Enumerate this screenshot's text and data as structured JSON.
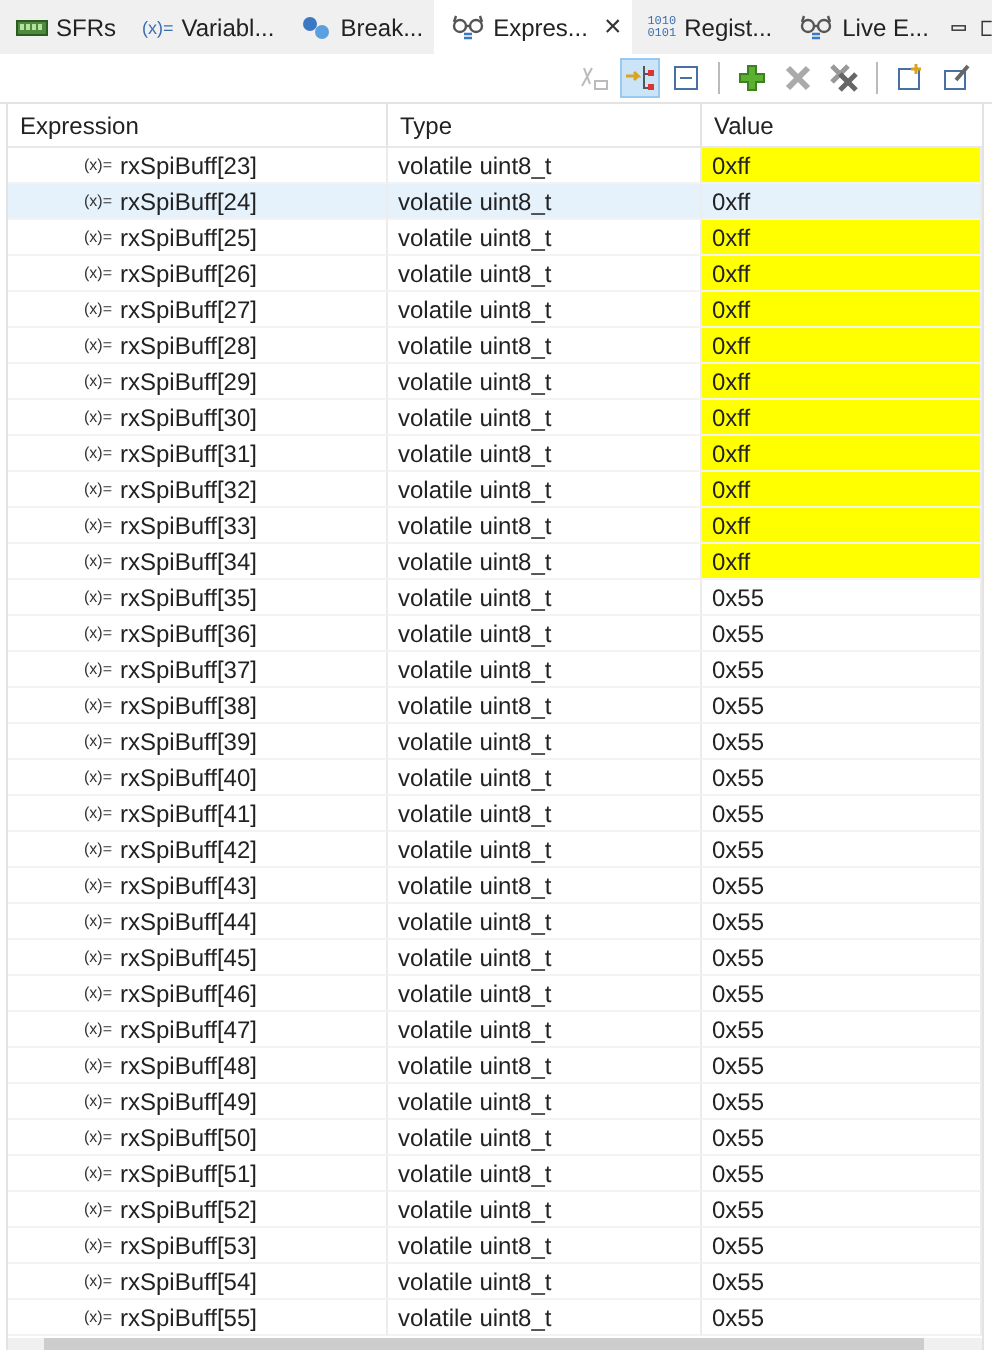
{
  "tabs": [
    {
      "label": "SFRs",
      "kind": "chip",
      "selected": false
    },
    {
      "label": "Variabl...",
      "kind": "text",
      "icon_text": "(x)=",
      "selected": false
    },
    {
      "label": "Break...",
      "kind": "dots",
      "selected": false
    },
    {
      "label": "Expres...",
      "kind": "glasses",
      "selected": true,
      "close": "×"
    },
    {
      "label": "Regist...",
      "kind": "binary",
      "icon_text": "1010\n0101",
      "selected": false
    },
    {
      "label": "Live E...",
      "kind": "glasses",
      "selected": false
    }
  ],
  "toolbar": [
    {
      "kind": "disabled-var",
      "on": false
    },
    {
      "kind": "arrow-tree",
      "on": true
    },
    {
      "kind": "collapse",
      "on": false
    },
    {
      "kind": "sep"
    },
    {
      "kind": "add",
      "on": false
    },
    {
      "kind": "remove",
      "on": false
    },
    {
      "kind": "remove-all",
      "on": false
    },
    {
      "kind": "sep"
    },
    {
      "kind": "new",
      "on": false
    },
    {
      "kind": "edit",
      "on": false
    }
  ],
  "table": {
    "columns": [
      "Expression",
      "Type",
      "Value"
    ],
    "rows": [
      {
        "icon": "(x)=",
        "expression": "rxSpiBuff[23]",
        "type": "volatile uint8_t",
        "value": "0xff",
        "changed": true,
        "selected": false
      },
      {
        "icon": "(x)=",
        "expression": "rxSpiBuff[24]",
        "type": "volatile uint8_t",
        "value": "0xff",
        "changed": false,
        "selected": true
      },
      {
        "icon": "(x)=",
        "expression": "rxSpiBuff[25]",
        "type": "volatile uint8_t",
        "value": "0xff",
        "changed": true,
        "selected": false
      },
      {
        "icon": "(x)=",
        "expression": "rxSpiBuff[26]",
        "type": "volatile uint8_t",
        "value": "0xff",
        "changed": true,
        "selected": false
      },
      {
        "icon": "(x)=",
        "expression": "rxSpiBuff[27]",
        "type": "volatile uint8_t",
        "value": "0xff",
        "changed": true,
        "selected": false
      },
      {
        "icon": "(x)=",
        "expression": "rxSpiBuff[28]",
        "type": "volatile uint8_t",
        "value": "0xff",
        "changed": true,
        "selected": false
      },
      {
        "icon": "(x)=",
        "expression": "rxSpiBuff[29]",
        "type": "volatile uint8_t",
        "value": "0xff",
        "changed": true,
        "selected": false
      },
      {
        "icon": "(x)=",
        "expression": "rxSpiBuff[30]",
        "type": "volatile uint8_t",
        "value": "0xff",
        "changed": true,
        "selected": false
      },
      {
        "icon": "(x)=",
        "expression": "rxSpiBuff[31]",
        "type": "volatile uint8_t",
        "value": "0xff",
        "changed": true,
        "selected": false
      },
      {
        "icon": "(x)=",
        "expression": "rxSpiBuff[32]",
        "type": "volatile uint8_t",
        "value": "0xff",
        "changed": true,
        "selected": false
      },
      {
        "icon": "(x)=",
        "expression": "rxSpiBuff[33]",
        "type": "volatile uint8_t",
        "value": "0xff",
        "changed": true,
        "selected": false
      },
      {
        "icon": "(x)=",
        "expression": "rxSpiBuff[34]",
        "type": "volatile uint8_t",
        "value": "0xff",
        "changed": true,
        "selected": false
      },
      {
        "icon": "(x)=",
        "expression": "rxSpiBuff[35]",
        "type": "volatile uint8_t",
        "value": "0x55",
        "changed": false,
        "selected": false
      },
      {
        "icon": "(x)=",
        "expression": "rxSpiBuff[36]",
        "type": "volatile uint8_t",
        "value": "0x55",
        "changed": false,
        "selected": false
      },
      {
        "icon": "(x)=",
        "expression": "rxSpiBuff[37]",
        "type": "volatile uint8_t",
        "value": "0x55",
        "changed": false,
        "selected": false
      },
      {
        "icon": "(x)=",
        "expression": "rxSpiBuff[38]",
        "type": "volatile uint8_t",
        "value": "0x55",
        "changed": false,
        "selected": false
      },
      {
        "icon": "(x)=",
        "expression": "rxSpiBuff[39]",
        "type": "volatile uint8_t",
        "value": "0x55",
        "changed": false,
        "selected": false
      },
      {
        "icon": "(x)=",
        "expression": "rxSpiBuff[40]",
        "type": "volatile uint8_t",
        "value": "0x55",
        "changed": false,
        "selected": false
      },
      {
        "icon": "(x)=",
        "expression": "rxSpiBuff[41]",
        "type": "volatile uint8_t",
        "value": "0x55",
        "changed": false,
        "selected": false
      },
      {
        "icon": "(x)=",
        "expression": "rxSpiBuff[42]",
        "type": "volatile uint8_t",
        "value": "0x55",
        "changed": false,
        "selected": false
      },
      {
        "icon": "(x)=",
        "expression": "rxSpiBuff[43]",
        "type": "volatile uint8_t",
        "value": "0x55",
        "changed": false,
        "selected": false
      },
      {
        "icon": "(x)=",
        "expression": "rxSpiBuff[44]",
        "type": "volatile uint8_t",
        "value": "0x55",
        "changed": false,
        "selected": false
      },
      {
        "icon": "(x)=",
        "expression": "rxSpiBuff[45]",
        "type": "volatile uint8_t",
        "value": "0x55",
        "changed": false,
        "selected": false
      },
      {
        "icon": "(x)=",
        "expression": "rxSpiBuff[46]",
        "type": "volatile uint8_t",
        "value": "0x55",
        "changed": false,
        "selected": false
      },
      {
        "icon": "(x)=",
        "expression": "rxSpiBuff[47]",
        "type": "volatile uint8_t",
        "value": "0x55",
        "changed": false,
        "selected": false
      },
      {
        "icon": "(x)=",
        "expression": "rxSpiBuff[48]",
        "type": "volatile uint8_t",
        "value": "0x55",
        "changed": false,
        "selected": false
      },
      {
        "icon": "(x)=",
        "expression": "rxSpiBuff[49]",
        "type": "volatile uint8_t",
        "value": "0x55",
        "changed": false,
        "selected": false
      },
      {
        "icon": "(x)=",
        "expression": "rxSpiBuff[50]",
        "type": "volatile uint8_t",
        "value": "0x55",
        "changed": false,
        "selected": false
      },
      {
        "icon": "(x)=",
        "expression": "rxSpiBuff[51]",
        "type": "volatile uint8_t",
        "value": "0x55",
        "changed": false,
        "selected": false
      },
      {
        "icon": "(x)=",
        "expression": "rxSpiBuff[52]",
        "type": "volatile uint8_t",
        "value": "0x55",
        "changed": false,
        "selected": false
      },
      {
        "icon": "(x)=",
        "expression": "rxSpiBuff[53]",
        "type": "volatile uint8_t",
        "value": "0x55",
        "changed": false,
        "selected": false
      },
      {
        "icon": "(x)=",
        "expression": "rxSpiBuff[54]",
        "type": "volatile uint8_t",
        "value": "0x55",
        "changed": false,
        "selected": false
      },
      {
        "icon": "(x)=",
        "expression": "rxSpiBuff[55]",
        "type": "volatile uint8_t",
        "value": "0x55",
        "changed": false,
        "selected": false
      }
    ]
  }
}
